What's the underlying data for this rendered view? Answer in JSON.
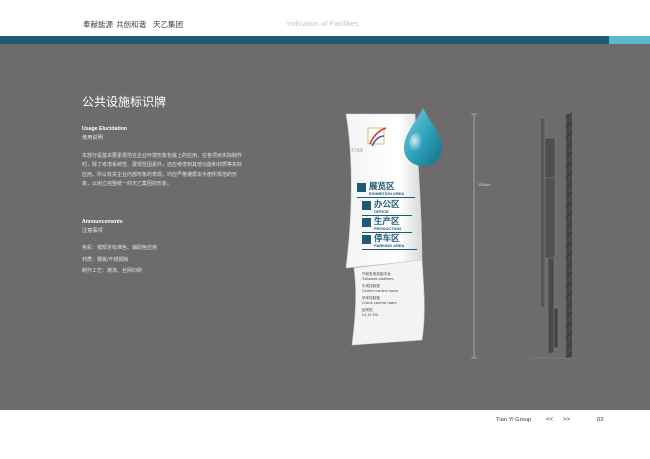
{
  "header": {
    "brand_left": "奉献能源",
    "brand_mid": "共创和谐",
    "brand_right": "天乙集团",
    "doc_title": "Indication of Facilities"
  },
  "section": {
    "title": "公共设施标识牌",
    "usage_en": "Usage Elucidation",
    "usage_cn": "使用说明",
    "usage_paragraph": "本部分是基本要素规范在企业环境形象包装上的应用，在各项目实际制作时，除了考虑系统性、展现性因素外，还应考虑到其他功能和材质等实际应用。所以有关企业内部形象的表现，均应严格遵循本手册所规范的形象，以树立完整统一的天乙集团的形象。",
    "announce_en": "Announcements",
    "announce_cn": "注意事项",
    "notes": [
      "色彩：按规定标准色、辅助色应用",
      "材质：钢板/不锈钢板",
      "制作工艺：烤漆、丝网印刷"
    ]
  },
  "sign": {
    "logo_text": "天乙集团",
    "areas": [
      {
        "cn": "展览区",
        "en": "EXHIBITION AREA",
        "icon": "exhibition-arrow-icon"
      },
      {
        "cn": "办公区",
        "en": "OFFICE",
        "icon": "office-arrow-icon"
      },
      {
        "cn": "生产区",
        "en": "PRODUCTION",
        "icon": "production-arrow-icon"
      },
      {
        "cn": "停车区",
        "en": "PARKING AREA",
        "icon": "parking-arrow-icon"
      }
    ],
    "floor": [
      {
        "cn": "汽轮发电机组平台",
        "en": "Turboset platform"
      },
      {
        "cn": "中央控制室",
        "en": "Center control room"
      },
      {
        "cn": "吊车控制室",
        "en": "Crane control room"
      },
      {
        "cn": "起吊机",
        "en": "LX J3 29t"
      }
    ],
    "dimension": "2000cm"
  },
  "footer": {
    "company": "Tian Yi Group",
    "prev": "<<",
    "next": ">>",
    "page": "03"
  },
  "colors": {
    "brand_dark": "#1e5a72",
    "brand_light": "#5ab9cb",
    "panel_gray": "#6d6b6b"
  }
}
